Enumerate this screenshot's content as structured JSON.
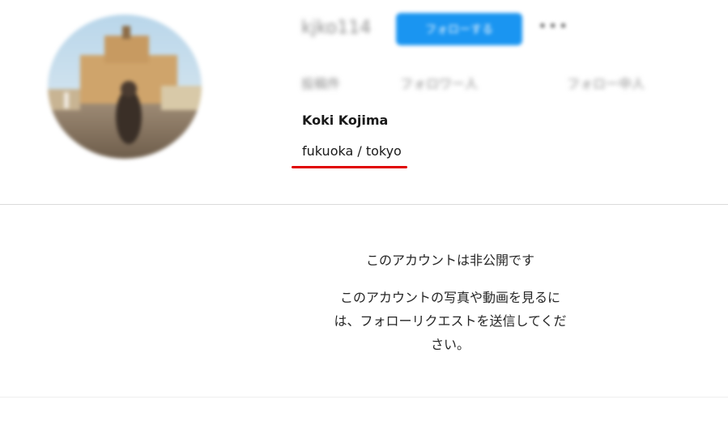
{
  "profile": {
    "username": "kjko114",
    "follow_button_label": "フォローする",
    "more_label": "•••",
    "stats": {
      "posts": "投稿件",
      "followers": "フォロワー人",
      "following": "フォロー中人"
    },
    "full_name": "Koki Kojima",
    "bio": "fukuoka / tokyo"
  },
  "private_notice": {
    "title": "このアカウントは非公開です",
    "message": "このアカウントの写真や動画を見るには、フォローリクエストを送信してください。"
  },
  "colors": {
    "follow_button": "#1a95f1",
    "highlight_underline": "#e00000",
    "divider": "#dbdbdb"
  },
  "icons": {
    "more": "more-dots-icon"
  }
}
